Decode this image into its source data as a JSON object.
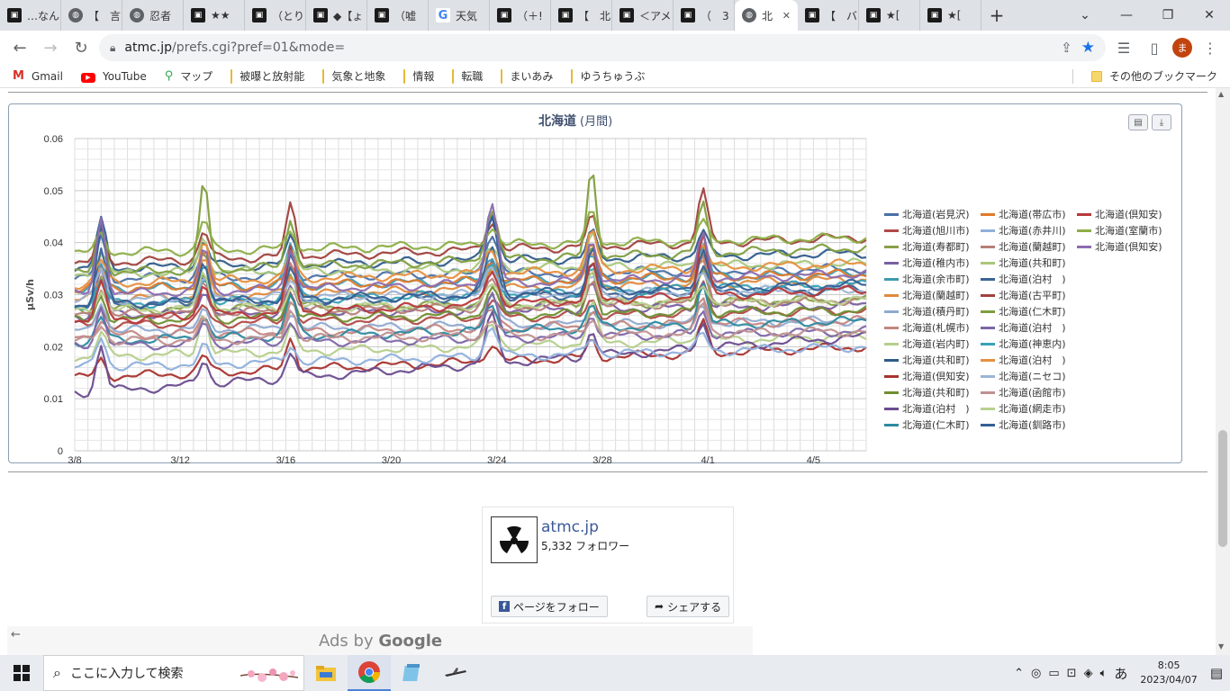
{
  "browser": {
    "tabs": [
      {
        "label": "…なん",
        "icon": "site-icon"
      },
      {
        "label": "【　言",
        "icon": "globe-icon"
      },
      {
        "label": "忍者",
        "icon": "globe-icon"
      },
      {
        "label": "★★",
        "icon": "site-icon"
      },
      {
        "label": "（とり",
        "icon": "site-icon"
      },
      {
        "label": "◆【ょ",
        "icon": "site-icon"
      },
      {
        "label": "（嘘",
        "icon": "site-icon"
      },
      {
        "label": "天気",
        "icon": "google-icon"
      },
      {
        "label": "（＋!",
        "icon": "site-icon"
      },
      {
        "label": "【　北",
        "icon": "site-icon"
      },
      {
        "label": "＜アメ",
        "icon": "site-icon"
      },
      {
        "label": "（　3",
        "icon": "site-icon"
      },
      {
        "label": "北",
        "icon": "globe-icon",
        "active": true
      },
      {
        "label": "【　バ",
        "icon": "site-icon"
      },
      {
        "label": "★[",
        "icon": "site-icon"
      },
      {
        "label": "★[",
        "icon": "site-icon"
      }
    ],
    "url_host": "atmc.jp",
    "url_path": "/prefs.cgi?pref=01&mode=",
    "avatar_letter": "ま",
    "bookmarks": [
      {
        "label": "Gmail",
        "icon": "gmail-icon"
      },
      {
        "label": "YouTube",
        "icon": "youtube-icon"
      },
      {
        "label": "マップ",
        "icon": "maps-icon"
      },
      {
        "label": "被曝と放射能",
        "icon": "folder-icon"
      },
      {
        "label": "気象と地象",
        "icon": "folder-icon"
      },
      {
        "label": "情報",
        "icon": "folder-icon"
      },
      {
        "label": "転職",
        "icon": "folder-icon"
      },
      {
        "label": "まいあみ",
        "icon": "folder-icon"
      },
      {
        "label": "ゆうちゅうぶ",
        "icon": "folder-icon"
      }
    ],
    "other_bookmarks": "その他のブックマーク"
  },
  "chart_data": {
    "type": "line",
    "title": "北海道",
    "subtitle": "(月間)",
    "ylabel": "μSv/h",
    "xlabel": "",
    "ylim": [
      0,
      0.06
    ],
    "yticks": [
      "0",
      "0.01",
      "0.02",
      "0.03",
      "0.04",
      "0.05",
      "0.06"
    ],
    "xticks": [
      "3/8",
      "3/12",
      "3/16",
      "3/20",
      "3/24",
      "3/28",
      "4/1",
      "4/5"
    ],
    "x_range_days": [
      0,
      30
    ],
    "grid": true,
    "legend_position": "right",
    "peaks_days": [
      1.0,
      4.9,
      8.2,
      15.8,
      19.6,
      23.8
    ],
    "series": [
      {
        "name": "北海道(岩見沢)",
        "color": "#4a6fa5",
        "base": 0.033,
        "peak": 0.008,
        "trend": 0.002
      },
      {
        "name": "北海道(旭川市)",
        "color": "#b04a47",
        "base": 0.024,
        "peak": 0.006,
        "trend": 0.003
      },
      {
        "name": "北海道(寿都町)",
        "color": "#8aa04a",
        "base": 0.027,
        "peak": 0.012,
        "trend": 0.002
      },
      {
        "name": "北海道(稚内市)",
        "color": "#7a5fa0",
        "base": 0.026,
        "peak": 0.009,
        "trend": 0.002
      },
      {
        "name": "北海道(余市町)",
        "color": "#3f9bb0",
        "base": 0.031,
        "peak": 0.008,
        "trend": 0.003
      },
      {
        "name": "北海道(蘭越町)",
        "color": "#e08a3c",
        "base": 0.029,
        "peak": 0.007,
        "trend": 0.004
      },
      {
        "name": "北海道(積丹町)",
        "color": "#90aad0",
        "base": 0.023,
        "peak": 0.006,
        "trend": 0.002
      },
      {
        "name": "北海道(札幌市)",
        "color": "#c48682",
        "base": 0.022,
        "peak": 0.006,
        "trend": 0.003
      },
      {
        "name": "北海道(岩内町)",
        "color": "#b5cf8a",
        "base": 0.018,
        "peak": 0.008,
        "trend": 0.004
      },
      {
        "name": "北海道(共和町)",
        "color": "#2f5c8a",
        "base": 0.035,
        "peak": 0.009,
        "trend": 0.003
      },
      {
        "name": "北海道(倶知安)",
        "color": "#a8332e",
        "base": 0.014,
        "peak": 0.006,
        "trend": 0.006
      },
      {
        "name": "北海道(共和町)",
        "color": "#6f8f2f",
        "base": 0.025,
        "peak": 0.009,
        "trend": 0.002
      },
      {
        "name": "北海道(泊村　)",
        "color": "#6a4c8e",
        "base": 0.011,
        "peak": 0.009,
        "trend": 0.011
      },
      {
        "name": "北海道(仁木町)",
        "color": "#2c8aa0",
        "base": 0.021,
        "peak": 0.008,
        "trend": 0.004
      },
      {
        "name": "北海道(帯広市)",
        "color": "#e07a2a",
        "base": 0.031,
        "peak": 0.007,
        "trend": 0.003
      },
      {
        "name": "北海道(赤井川)",
        "color": "#8fb0dc",
        "base": 0.016,
        "peak": 0.006,
        "trend": 0.004
      },
      {
        "name": "北海道(蘭越町)",
        "color": "#b77f7a",
        "base": 0.026,
        "peak": 0.01,
        "trend": 0.003
      },
      {
        "name": "北海道(共和町)",
        "color": "#a9c77a",
        "base": 0.034,
        "peak": 0.007,
        "trend": 0.002
      },
      {
        "name": "北海道(泊村　)",
        "color": "#3a6496",
        "base": 0.028,
        "peak": 0.01,
        "trend": 0.003
      },
      {
        "name": "北海道(古平町)",
        "color": "#a0413d",
        "base": 0.036,
        "peak": 0.01,
        "trend": 0.005
      },
      {
        "name": "北海道(仁木町)",
        "color": "#7f9e3e",
        "base": 0.034,
        "peak": 0.017,
        "trend": 0.005
      },
      {
        "name": "北海道(泊村　)",
        "color": "#7d66a8",
        "base": 0.02,
        "peak": 0.008,
        "trend": 0.003
      },
      {
        "name": "北海道(神恵内)",
        "color": "#39a2b8",
        "base": 0.028,
        "peak": 0.009,
        "trend": 0.004
      },
      {
        "name": "北海道(泊村　)",
        "color": "#e6903f",
        "base": 0.032,
        "peak": 0.008,
        "trend": 0.004
      },
      {
        "name": "北海道(ニセコ)",
        "color": "#9cb4d6",
        "base": 0.029,
        "peak": 0.006,
        "trend": 0.002
      },
      {
        "name": "北海道(函館市)",
        "color": "#c09090",
        "base": 0.021,
        "peak": 0.006,
        "trend": 0.002
      },
      {
        "name": "北海道(網走市)",
        "color": "#b9d18f",
        "base": 0.027,
        "peak": 0.007,
        "trend": 0.002
      },
      {
        "name": "北海道(釧路市)",
        "color": "#345f94",
        "base": 0.028,
        "peak": 0.015,
        "trend": 0.004
      },
      {
        "name": "北海道(倶知安)",
        "color": "#b8383a",
        "base": 0.025,
        "peak": 0.012,
        "trend": 0.006
      },
      {
        "name": "北海道(室蘭市)",
        "color": "#8cae46",
        "base": 0.038,
        "peak": 0.006,
        "trend": 0.003
      },
      {
        "name": "北海道(倶知安)",
        "color": "#8c6cb0",
        "base": 0.03,
        "peak": 0.015,
        "trend": 0.004
      }
    ]
  },
  "fb": {
    "name": "atmc.jp",
    "followers": "5,332 フォロワー",
    "follow_label": "ページをフォロー",
    "share_label": "シェアする"
  },
  "ads": {
    "prefix": "Ads by",
    "brand": "Google"
  },
  "taskbar": {
    "search_placeholder": "ここに入力して検索",
    "ime": "あ",
    "time": "8:05",
    "date": "2023/04/07"
  }
}
